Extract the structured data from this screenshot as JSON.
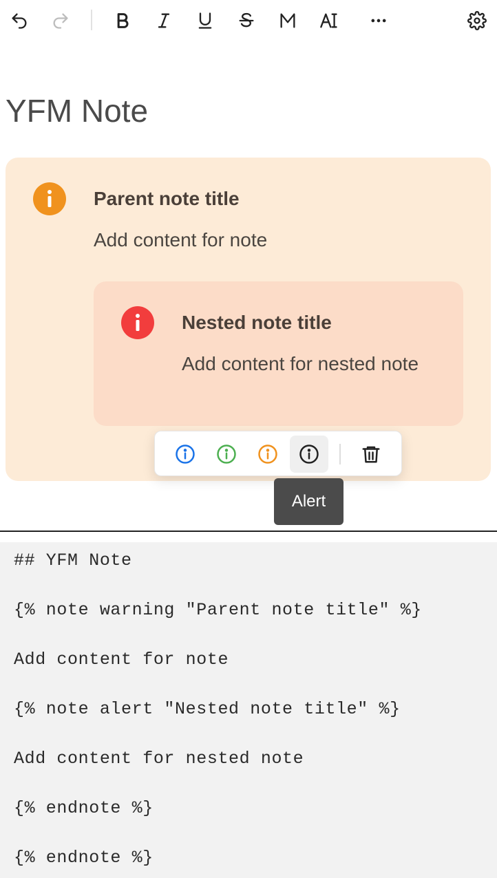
{
  "toolbar": {
    "buttons": [
      {
        "name": "undo-icon",
        "label": "Undo"
      },
      {
        "name": "redo-icon",
        "label": "Redo"
      },
      {
        "name": "bold-icon",
        "label": "Bold"
      },
      {
        "name": "italic-icon",
        "label": "Italic"
      },
      {
        "name": "underline-icon",
        "label": "Underline"
      },
      {
        "name": "strikethrough-icon",
        "label": "Strikethrough"
      },
      {
        "name": "monospace-icon",
        "label": "Monospace"
      },
      {
        "name": "text-type-icon",
        "label": "Text"
      },
      {
        "name": "more-icon",
        "label": "More"
      },
      {
        "name": "settings-icon",
        "label": "Settings"
      }
    ],
    "redo_disabled": true
  },
  "document": {
    "title": "YFM Note"
  },
  "parent_note": {
    "type": "warning",
    "title": "Parent note title",
    "content": "Add content for note",
    "color": "#f0921e",
    "background": "#fdebd7"
  },
  "nested_note": {
    "type": "alert",
    "title": "Nested note title",
    "content": "Add content for nested note",
    "color": "#f23d3d",
    "background": "#fcdcc8"
  },
  "note_popup": {
    "options": [
      {
        "name": "note-info-icon",
        "color": "#1a73e8"
      },
      {
        "name": "note-tip-icon",
        "color": "#4caf50"
      },
      {
        "name": "note-warning-icon",
        "color": "#f0921e"
      },
      {
        "name": "note-alert-icon",
        "color": "#222222",
        "active": true
      }
    ],
    "delete": "trash-icon"
  },
  "tooltip": {
    "text": "Alert"
  },
  "markup": {
    "lines": [
      "## YFM Note",
      "{% note warning \"Parent note title\" %}",
      "Add content for note",
      "{% note alert \"Nested note title\" %}",
      "Add content for nested note",
      "{% endnote %}",
      "{% endnote %}"
    ]
  }
}
